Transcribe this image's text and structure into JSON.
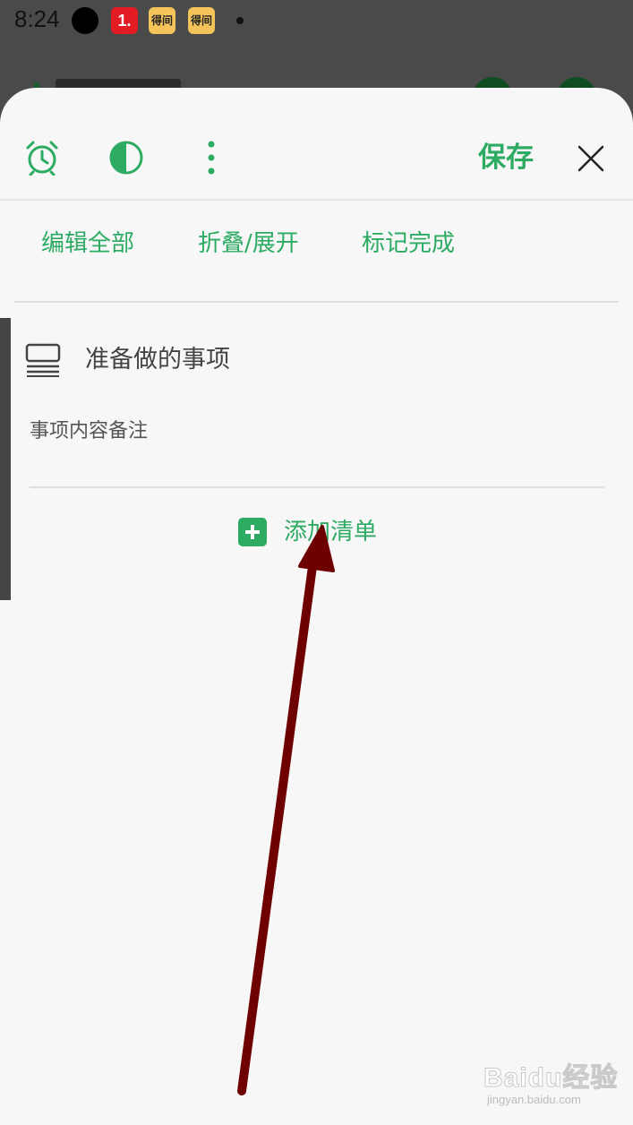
{
  "status_bar": {
    "time": "8:24",
    "app1_label": "1.",
    "app2_label": "得间",
    "app3_label": "得间"
  },
  "toolbar": {
    "icons": [
      "alarm-icon",
      "theme-contrast-icon",
      "more-vertical-icon",
      "close-icon"
    ],
    "save_label": "保存"
  },
  "actions": {
    "edit_all": "编辑全部",
    "fold_expand": "折叠/展开",
    "mark_done": "标记完成"
  },
  "checklist": {
    "title": "准备做的事项",
    "note": "事项内容备注",
    "add_list_label": "添加清单"
  },
  "colors": {
    "accent": "#2dab63",
    "sheet_background": "#f7f7f7",
    "scrim": "#4a4a4a",
    "annotation_arrow": "#6f0000"
  },
  "watermark": {
    "brand": "Baidu经验",
    "url": "jingyan.baidu.com"
  }
}
